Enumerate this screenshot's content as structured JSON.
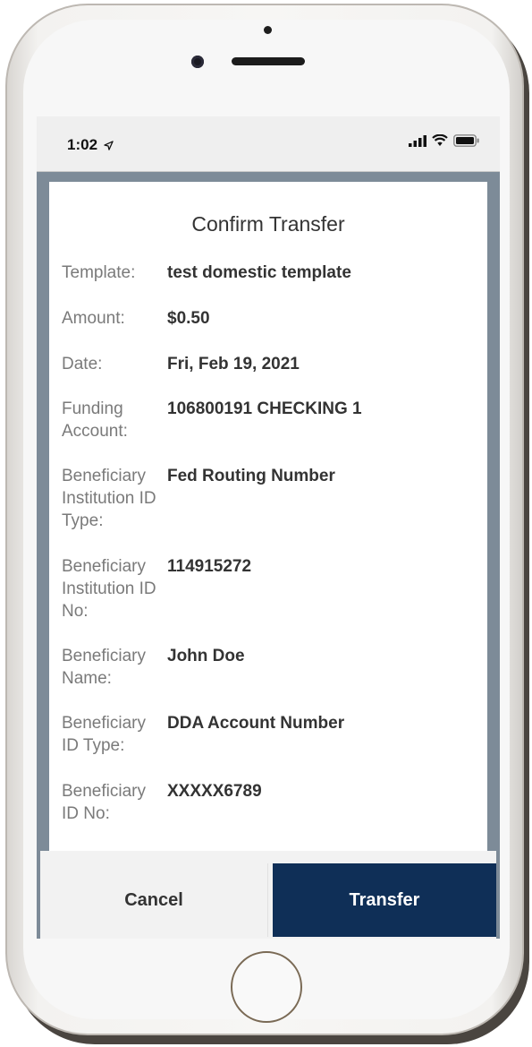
{
  "status_bar": {
    "time": "1:02",
    "icons": [
      "location-arrow-icon",
      "signal-icon",
      "wifi-icon",
      "battery-icon"
    ]
  },
  "dialog": {
    "title": "Confirm Transfer",
    "details": [
      {
        "label": "Template:",
        "value": "test domestic template"
      },
      {
        "label": "Amount:",
        "value": "$0.50"
      },
      {
        "label": "Date:",
        "value": "Fri, Feb 19, 2021"
      },
      {
        "label": "Funding Account:",
        "value": "106800191 CHECKING 1"
      },
      {
        "label": "Beneficiary Institution ID Type:",
        "value": "Fed Routing Number"
      },
      {
        "label": "Beneficiary Institution ID No:",
        "value": "114915272"
      },
      {
        "label": "Beneficiary Name:",
        "value": "John Doe"
      },
      {
        "label": "Beneficiary ID Type:",
        "value": "DDA Account Number"
      },
      {
        "label": "Beneficiary ID No:",
        "value": "XXXXX6789"
      }
    ]
  },
  "buttons": {
    "cancel_label": "Cancel",
    "transfer_label": "Transfer"
  },
  "colors": {
    "primary": "#0f2f57",
    "backdrop": "#7d8b98"
  }
}
